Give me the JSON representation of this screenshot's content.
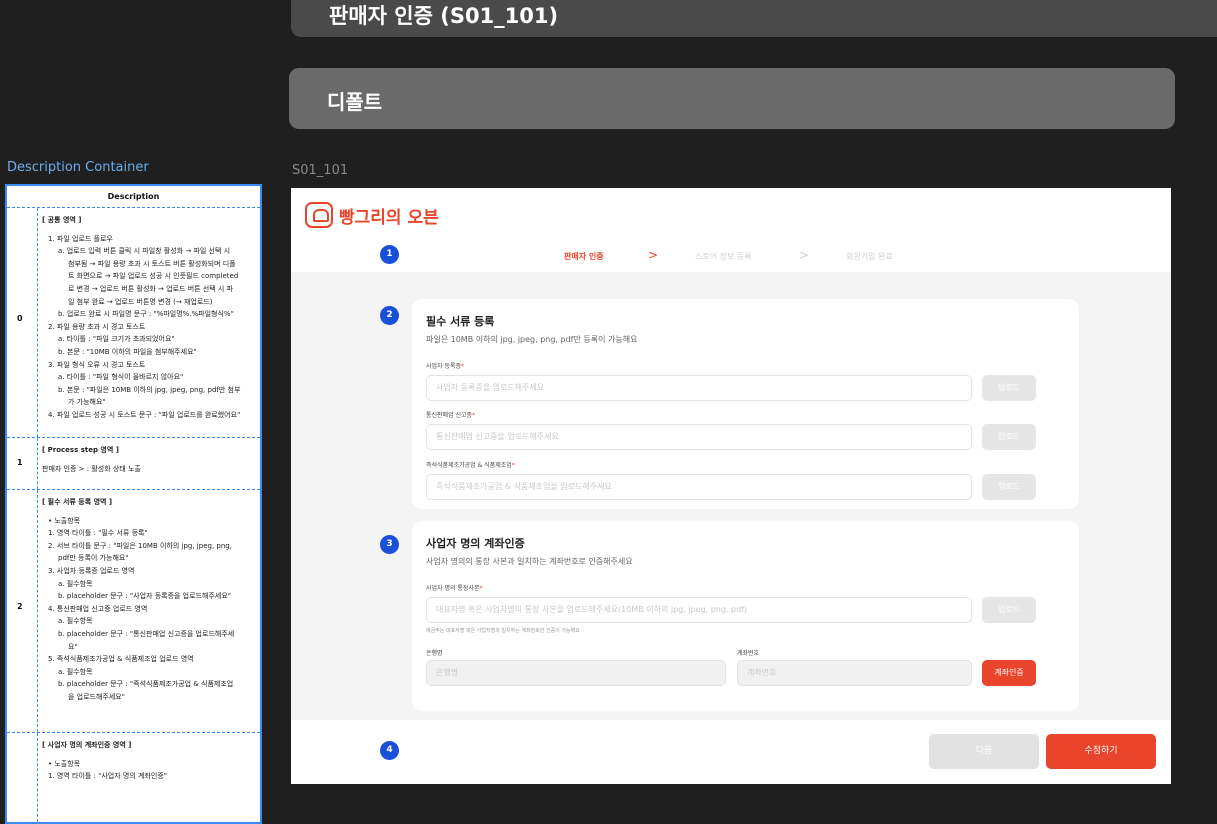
{
  "header": {
    "title": "판매자 인증 (S01_101)",
    "section": "디폴트",
    "frame_label": "S01_101"
  },
  "description": {
    "panel_title": "Description Container",
    "column_header": "Description",
    "rows": [
      {
        "num": "0",
        "title": "[ 공통 영역 ]",
        "lines": [
          {
            "lvl": 1,
            "text": "1. 파일 업로드 플로우"
          },
          {
            "lvl": 2,
            "text": "a. 업로드 입력 버튼 클릭 시 파일창 활성화 → 파일 선택 시"
          },
          {
            "lvl": 3,
            "text": "첨부됨 → 파일 용량 초과 시 토스트 버튼 활성화되며 디폴"
          },
          {
            "lvl": 3,
            "text": "트 화면으로 → 파일 업로드 성공 시 인풋필드 completed"
          },
          {
            "lvl": 3,
            "text": "로 변경 → 업로드 버튼 활성화 → 업로드 버튼 선택 시 파"
          },
          {
            "lvl": 3,
            "text": "일 첨부 완료 → 업로드 버튼명 변경 (→ 재업로드)"
          },
          {
            "lvl": 2,
            "text": "b. 업로드 완료 시 파일명 문구 : \"%파일명%.%파일형식%\""
          },
          {
            "lvl": 1,
            "text": "2. 파일 용량 초과 시 경고 토스트"
          },
          {
            "lvl": 2,
            "text": "a. 타이틀 : \"파일 크기가 초과되었어요\""
          },
          {
            "lvl": 2,
            "text": "b. 본문 : \"10MB 이하의 파일을 첨부해주세요\""
          },
          {
            "lvl": 1,
            "text": "3. 파일 형식 오류 시 경고 토스트"
          },
          {
            "lvl": 2,
            "text": "a. 타이틀 : \"파일 형식이 올바르지 않아요\""
          },
          {
            "lvl": 2,
            "text": "b. 본문 : \"파일은 10MB 이하의 jpg, jpeg, png, pdf만 첨부"
          },
          {
            "lvl": 3,
            "text": "가 가능해요\""
          },
          {
            "lvl": 1,
            "text": "4. 파일 업로드 성공 시 토스트 문구 : \"파일 업로드를 완료했어요\""
          }
        ]
      },
      {
        "num": "1",
        "title": "[ Process step 영역 ]",
        "lines": [
          {
            "lvl": 0,
            "text": "판매자 인증 > : 활성화 상태 노출"
          }
        ]
      },
      {
        "num": "2",
        "title": "[ 필수 서류 등록 영역 ]",
        "lines": [
          {
            "lvl": 1,
            "text": "• 노출항목"
          },
          {
            "lvl": 1,
            "text": "1. 영역 타이틀 : \"필수 서류 등록\""
          },
          {
            "lvl": 1,
            "text": "2. 서브 타이틀 문구 : \"파일은 10MB 이하의 jpg, jpeg, png,"
          },
          {
            "lvl": 2,
            "text": "pdf만 등록이 가능해요\""
          },
          {
            "lvl": 1,
            "text": "3. 사업자 등록증 업로드 영역"
          },
          {
            "lvl": 2,
            "text": "a. 필수항목"
          },
          {
            "lvl": 2,
            "text": "b. placeholder 문구 : \"사업자 등록증을 업로드해주세요\""
          },
          {
            "lvl": 1,
            "text": "4. 통신판매업 신고증 업로드 영역"
          },
          {
            "lvl": 2,
            "text": "a. 필수항목"
          },
          {
            "lvl": 2,
            "text": "b. placeholder 문구 : \"통신판매업 신고증을 업로드해주세"
          },
          {
            "lvl": 3,
            "text": "요\""
          },
          {
            "lvl": 1,
            "text": "5. 즉석식품제조가공업 & 식품제조업 업로드 영역"
          },
          {
            "lvl": 2,
            "text": "a. 필수항목"
          },
          {
            "lvl": 2,
            "text": "b. placeholder 문구 : \"즉석식품제조가공업 & 식품제조업"
          },
          {
            "lvl": 3,
            "text": "을 업로드해주세요\""
          }
        ]
      },
      {
        "num": "",
        "title": "[ 사업자 명의 계좌인증 영역 ]",
        "lines": [
          {
            "lvl": 1,
            "text": "• 노출항목"
          },
          {
            "lvl": 1,
            "text": "1. 영역 타이틀 : \"사업자 명의 계좌인증\""
          }
        ]
      }
    ]
  },
  "app": {
    "logo_text": "빵그리의 오븐",
    "badges": [
      "1",
      "2",
      "3",
      "4"
    ],
    "steps": [
      {
        "label": "판매자 인증",
        "state": "active"
      },
      {
        "label": "스토어 정보 등록",
        "state": "inactive"
      },
      {
        "label": "회원가입 완료",
        "state": "inactive"
      }
    ],
    "step_separator": ">",
    "documents": {
      "title": "필수 서류 등록",
      "subtitle": "파일은 10MB 이하의 jpg, jpeg, png, pdf만 등록이 가능해요",
      "fields": [
        {
          "label": "사업자 등록증",
          "required": "*",
          "placeholder": "사업자 등록증을 업로드해주세요",
          "button": "업로드"
        },
        {
          "label": "통신판매업 신고증",
          "required": "*",
          "placeholder": "통신판매업 신고증을 업로드해주세요",
          "button": "업로드"
        },
        {
          "label": "즉석식품제조가공업 & 식품제조업",
          "required": "*",
          "placeholder": "즉석식품제조가공업 & 식품제조업을 업로드해주세요",
          "button": "업로드"
        }
      ]
    },
    "account": {
      "title": "사업자 명의 계좌인증",
      "subtitle": "사업자 명의의 통장 사본과 일치하는 계좌번호로 인증해주세요",
      "copy_label": "사업자 명의 통장사본",
      "copy_required": "*",
      "copy_placeholder": "대표자명 혹은 사업자명의 통장 사본을 업로드해주세요(10MB 이하의 jpg, jpeg, png, pdf)",
      "copy_button": "업로드",
      "hint": "예금주는 대표자명 혹은 사업자명과 일치하는 계좌번호만 인증이 가능해요",
      "bank_label": "은행명",
      "bank_placeholder": "은행명",
      "account_label": "계좌번호",
      "account_placeholder": "계좌번호",
      "verify_button": "계좌인증"
    },
    "footer": {
      "next": "다음",
      "edit": "수정하기"
    }
  },
  "colors": {
    "accent": "#e8452c",
    "badge": "#1a4fd8",
    "panel_border": "#3a8cf0"
  }
}
